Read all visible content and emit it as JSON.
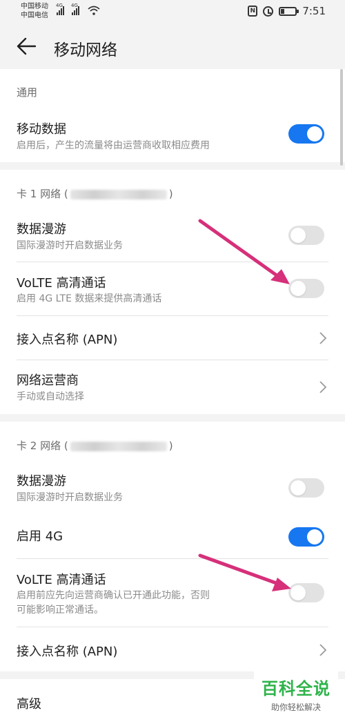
{
  "status_bar": {
    "carrier1": "中国移动",
    "carrier2": "中国电信",
    "net1": "4G",
    "net2": "4G",
    "nfc": "N",
    "time": "7:51"
  },
  "header": {
    "title": "移动网络"
  },
  "general": {
    "heading": "通用",
    "mobile_data": {
      "title": "移动数据",
      "subtitle": "启用后，产生的流量将由运营商收取相应费用",
      "enabled": true
    }
  },
  "sim1": {
    "heading_prefix": "卡 1 网络 (",
    "heading_suffix": ")",
    "roaming": {
      "title": "数据漫游",
      "subtitle": "国际漫游时开启数据业务",
      "enabled": false
    },
    "volte": {
      "title": "VoLTE 高清通话",
      "subtitle": "启用 4G LTE 数据来提供高清通话",
      "enabled": false
    },
    "apn": {
      "title": "接入点名称 (APN)"
    },
    "carrier": {
      "title": "网络运营商",
      "subtitle": "手动或自动选择"
    }
  },
  "sim2": {
    "heading_prefix": "卡 2 网络 (",
    "heading_suffix": ")",
    "roaming": {
      "title": "数据漫游",
      "subtitle": "国际漫游时开启数据业务",
      "enabled": false
    },
    "enable_4g": {
      "title": "启用 4G",
      "enabled": true
    },
    "volte": {
      "title": "VoLTE 高清通话",
      "subtitle_line1": "启用前应先向运营商确认已开通此功能，否则",
      "subtitle_line2": "可能影响正常通话。",
      "enabled": false
    },
    "apn": {
      "title": "接入点名称 (APN)"
    }
  },
  "advanced": {
    "title": "高级"
  },
  "watermark": {
    "logo": "百科全说",
    "sub": "助你轻松解决"
  },
  "colors": {
    "accent": "#1677f0",
    "arrow": "#d6307a",
    "watermark": "#2fb34a"
  }
}
